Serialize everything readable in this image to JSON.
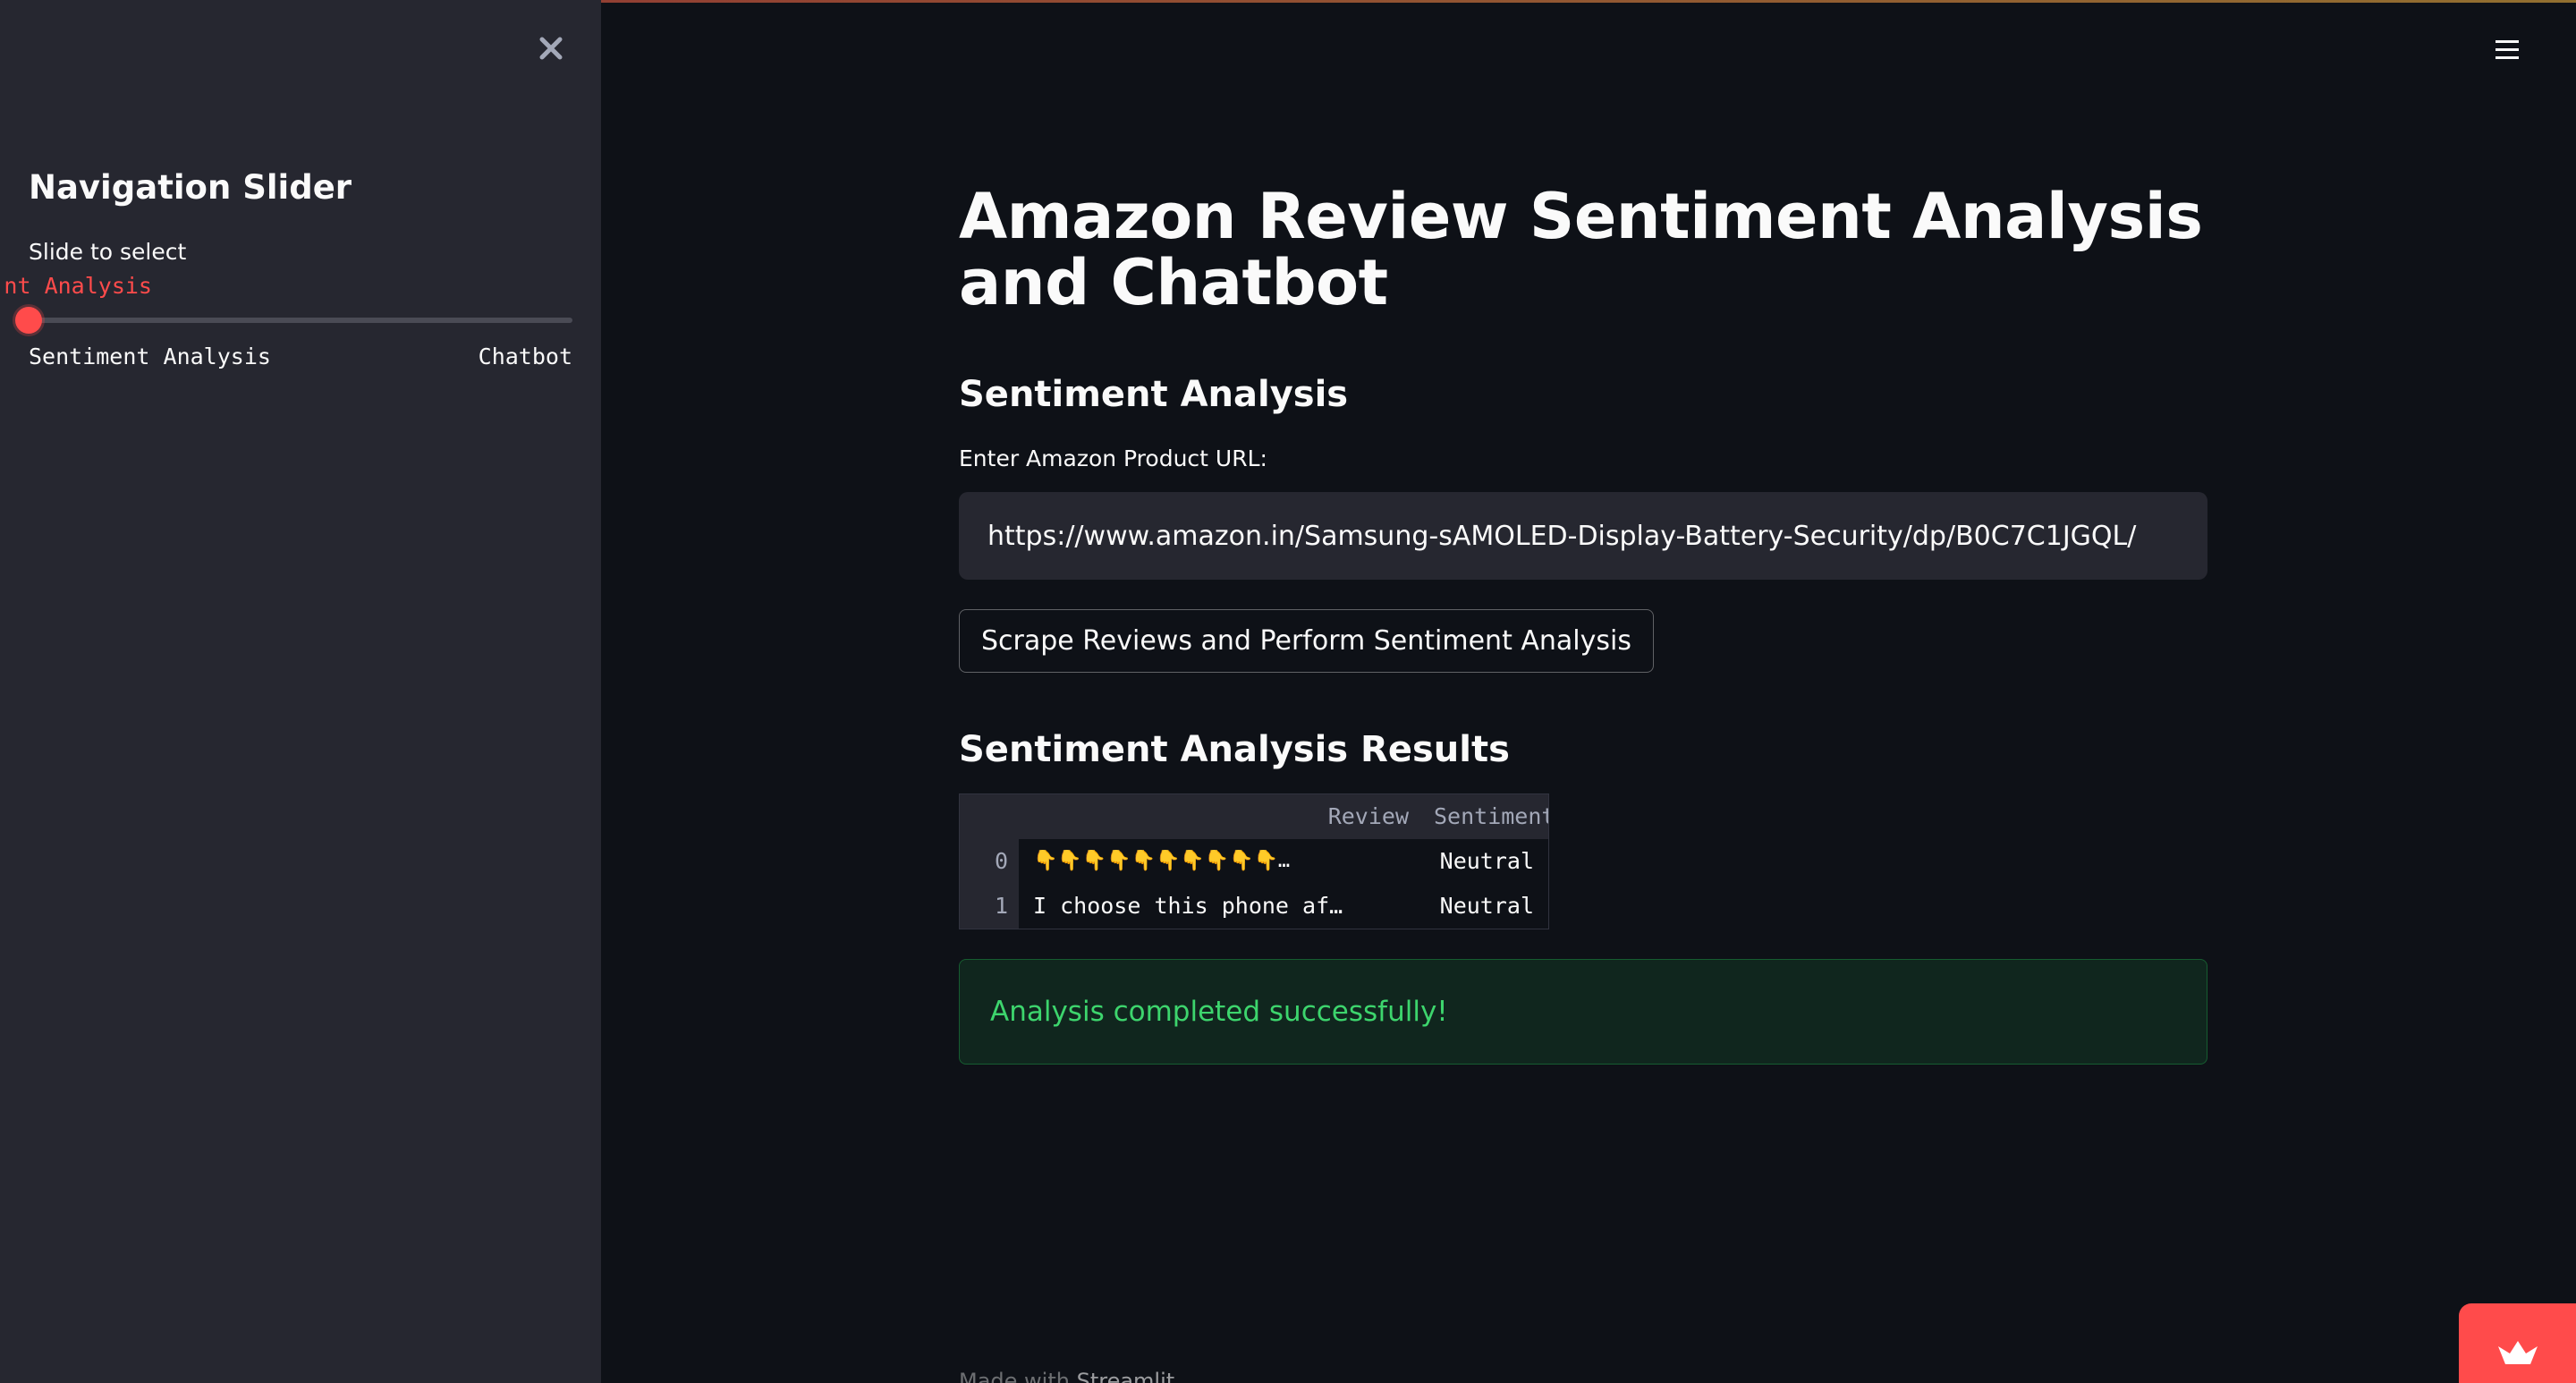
{
  "sidebar": {
    "title": "Navigation Slider",
    "slider_label": "Slide to select",
    "slider_value_visible": "nt Analysis",
    "slider_min_label": "Sentiment Analysis",
    "slider_max_label": "Chatbot",
    "slider_level": 0
  },
  "main": {
    "title": "Amazon Review Sentiment Analysis and Chatbot",
    "section_heading": "Sentiment Analysis",
    "url_label": "Enter Amazon Product URL:",
    "url_value": "https://www.amazon.in/Samsung-sAMOLED-Display-Battery-Security/dp/B0C7C1JGQL/",
    "scrape_button": "Scrape Reviews and Perform Sentiment Analysis",
    "results_heading": "Sentiment Analysis Results",
    "table": {
      "columns": [
        "Review",
        "Sentiment"
      ],
      "rows": [
        {
          "index": "0",
          "review": "👇👇👇👇👇👇👇👇👇👇…",
          "sentiment": "Neutral"
        },
        {
          "index": "1",
          "review": "I choose this phone af…",
          "sentiment": "Neutral"
        }
      ]
    },
    "success_message": "Analysis completed successfully!"
  },
  "footer": {
    "prefix": "Made with ",
    "brand": "Streamlit"
  },
  "colors": {
    "accent": "#ff4b4b",
    "success": "#3dd56d",
    "background": "#0e1117",
    "sidebar": "#262730"
  },
  "icons": {
    "close": "close-icon",
    "menu": "hamburger-menu-icon",
    "deploy": "streamlit-crown-icon"
  }
}
